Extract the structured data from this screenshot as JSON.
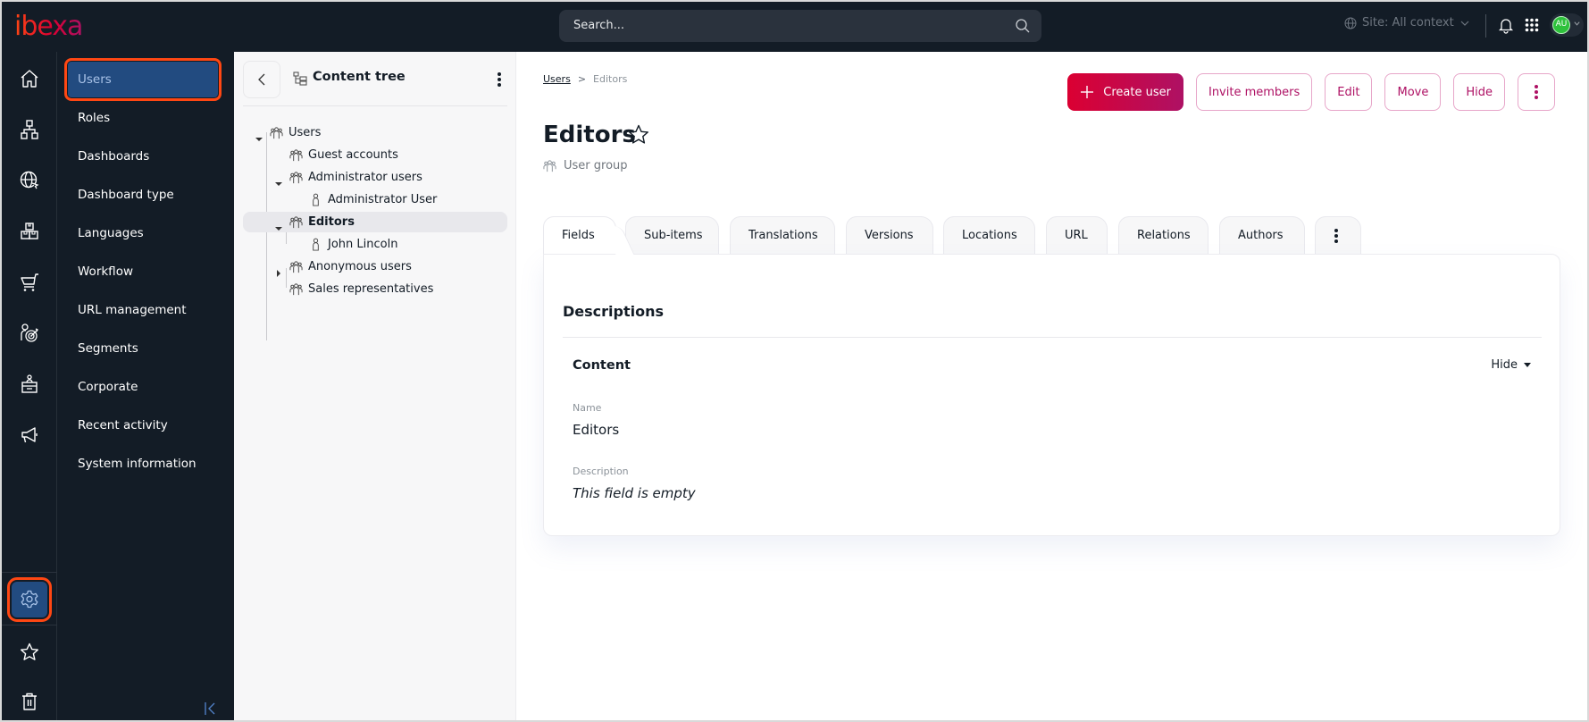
{
  "topbar": {
    "brand": "ibexa",
    "search_placeholder": "Search...",
    "site_context": "Site: All context",
    "avatar_initials": "AU"
  },
  "rail": {
    "items": [
      {
        "icon": "home-icon"
      },
      {
        "icon": "structure-icon"
      },
      {
        "icon": "globe-icon"
      },
      {
        "icon": "products-icon"
      },
      {
        "icon": "cart-icon"
      },
      {
        "icon": "target-user-icon"
      },
      {
        "icon": "corporate-icon"
      },
      {
        "icon": "megaphone-icon"
      }
    ],
    "bottom": [
      {
        "icon": "gear-icon",
        "active": true
      },
      {
        "icon": "star-icon"
      },
      {
        "icon": "trash-icon"
      }
    ]
  },
  "nav": {
    "items": [
      {
        "label": "Users",
        "active": true
      },
      {
        "label": "Roles"
      },
      {
        "label": "Dashboards"
      },
      {
        "label": "Dashboard type"
      },
      {
        "label": "Languages"
      },
      {
        "label": "Workflow"
      },
      {
        "label": "URL management"
      },
      {
        "label": "Segments"
      },
      {
        "label": "Corporate"
      },
      {
        "label": "Recent activity"
      },
      {
        "label": "System information"
      }
    ]
  },
  "tree": {
    "title": "Content tree",
    "rows": [
      {
        "label": "Users",
        "type": "group",
        "expanded": true
      },
      {
        "label": "Guest accounts",
        "type": "group"
      },
      {
        "label": "Administrator users",
        "type": "group",
        "expanded": true
      },
      {
        "label": "Administrator User",
        "type": "user"
      },
      {
        "label": "Editors",
        "type": "group",
        "expanded": true,
        "selected": true
      },
      {
        "label": "John Lincoln",
        "type": "user"
      },
      {
        "label": "Anonymous users",
        "type": "group",
        "expanded": false
      },
      {
        "label": "Sales representatives",
        "type": "group"
      }
    ]
  },
  "main": {
    "breadcrumb": {
      "parent": "Users",
      "separator": ">",
      "current": "Editors"
    },
    "title": "Editors",
    "content_type": "User group",
    "actions": {
      "create": "Create user",
      "invite": "Invite members",
      "edit": "Edit",
      "move": "Move",
      "hide": "Hide"
    },
    "tabs": [
      "Fields",
      "Sub-items",
      "Translations",
      "Versions",
      "Locations",
      "URL",
      "Relations",
      "Authors"
    ],
    "active_tab": "Fields",
    "panel": {
      "heading": "Descriptions",
      "group_title": "Content",
      "group_toggle": "Hide",
      "fields": [
        {
          "label": "Name",
          "value": "Editors"
        },
        {
          "label": "Description",
          "value": "This field is empty",
          "empty": true
        }
      ]
    }
  },
  "colors": {
    "brand_gradient_start": "#db0032",
    "brand_gradient_end": "#ae1164",
    "sidebar_bg": "#131c26",
    "active_nav": "#224b80",
    "highlight_outline": "#ff4713"
  }
}
